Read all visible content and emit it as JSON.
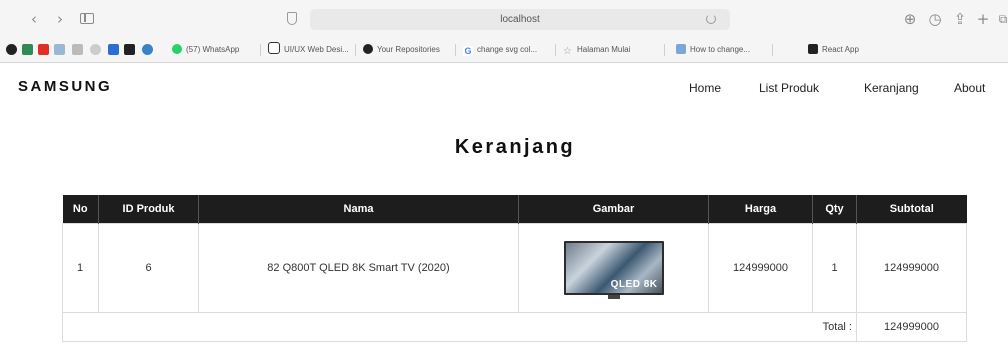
{
  "browser": {
    "url": "localhost",
    "bookmarks": [
      "(57) WhatsApp",
      "UI/UX Web Desi...",
      "Your Repositories",
      "change svg col...",
      "Halaman Mulai",
      "How to change...",
      "React App"
    ]
  },
  "site": {
    "brand": "SAMSUNG",
    "nav": [
      "Home",
      "List Produk",
      "Keranjang",
      "About"
    ]
  },
  "page": {
    "title": "Keranjang"
  },
  "cart": {
    "columns": [
      "No",
      "ID Produk",
      "Nama",
      "Gambar",
      "Harga",
      "Qty",
      "Subtotal"
    ],
    "rows": [
      {
        "no": "1",
        "id_produk": "6",
        "nama": "82 Q800T QLED 8K Smart TV (2020)",
        "gambar_label": "QLED 8K",
        "harga": "124999000",
        "qty": "1",
        "subtotal": "124999000"
      }
    ],
    "total_label": "Total :",
    "total_value": "124999000"
  },
  "colors": {
    "header_bg": "#1d1d1d",
    "header_text": "#ffffff",
    "border": "#dcdcdc"
  }
}
